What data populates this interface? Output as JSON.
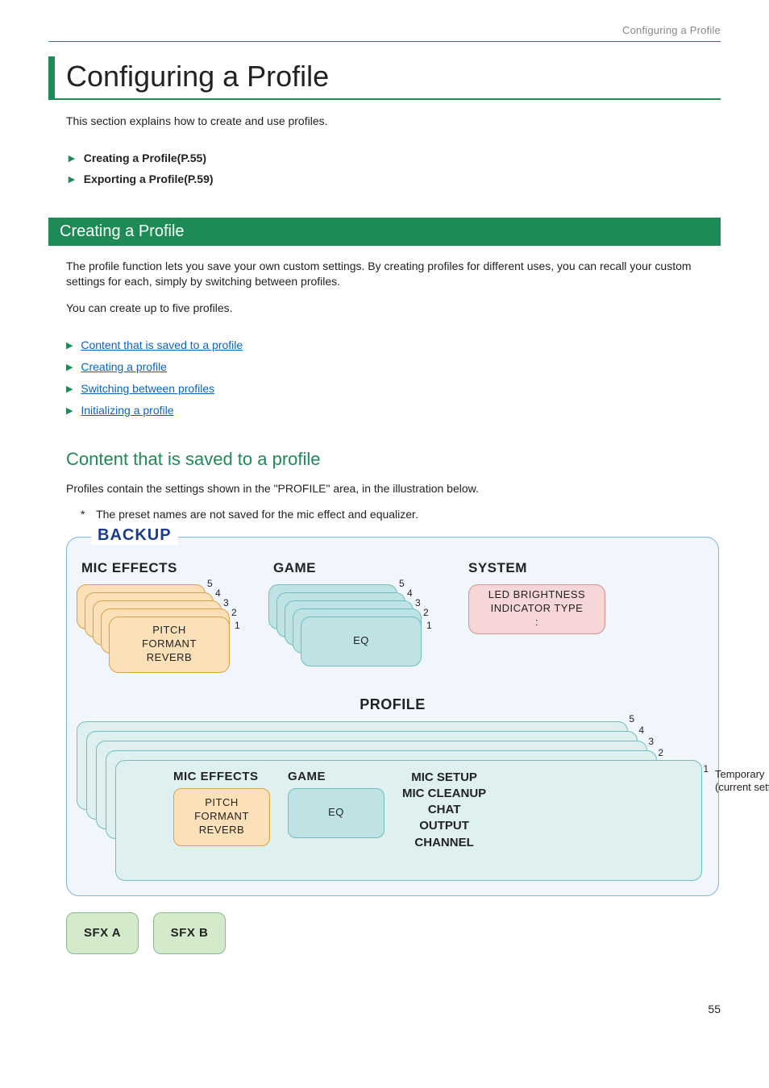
{
  "header": {
    "label": "Configuring a Profile"
  },
  "title": "Configuring a Profile",
  "intro": "This section explains how to create and use profiles.",
  "toc": {
    "items": [
      "Creating a Profile(P.55)",
      "Exporting a Profile(P.59)"
    ]
  },
  "section": {
    "title": "Creating a Profile",
    "p1": "The profile function lets you save your own custom settings. By creating profiles for different uses, you can recall your custom settings for each, simply by switching between profiles.",
    "p2": "You can create up to five profiles.",
    "links": [
      "Content that is saved to a profile",
      "Creating a profile",
      "Switching between profiles",
      "Initializing a profile"
    ]
  },
  "subheading": "Content that is saved to a profile",
  "sub_p": "Profiles contain the settings shown in the \"PROFILE\" area, in the illustration below.",
  "note": "The preset names are not saved for the mic effect and equalizer.",
  "diagram": {
    "backup_label": "BACKUP",
    "mic_effects": {
      "title": "MIC EFFECTS",
      "lines": [
        "PITCH",
        "FORMANT",
        "REVERB"
      ],
      "nums": [
        "5",
        "4",
        "3",
        "2",
        "1"
      ]
    },
    "game": {
      "title": "GAME",
      "lines": [
        "EQ"
      ],
      "nums": [
        "5",
        "4",
        "3",
        "2",
        "1"
      ]
    },
    "system": {
      "title": "SYSTEM",
      "lines": [
        "LED BRIGHTNESS",
        "INDICATOR TYPE",
        ":"
      ]
    },
    "profile": {
      "label": "PROFILE",
      "nums": [
        "5",
        "4",
        "3",
        "2",
        "1"
      ],
      "mic_title": "MIC EFFECTS",
      "mic_lines": [
        "PITCH",
        "FORMANT",
        "REVERB"
      ],
      "game_title": "GAME",
      "game_lines": [
        "EQ"
      ],
      "sys_lines": [
        "MIC SETUP",
        "MIC CLEANUP",
        "CHAT",
        "OUTPUT",
        "CHANNEL"
      ],
      "temp_note_l1": "Temporary",
      "temp_note_l2": "(current settings)"
    },
    "sfx": {
      "a": "SFX A",
      "b": "SFX B"
    }
  },
  "page_number": "55"
}
